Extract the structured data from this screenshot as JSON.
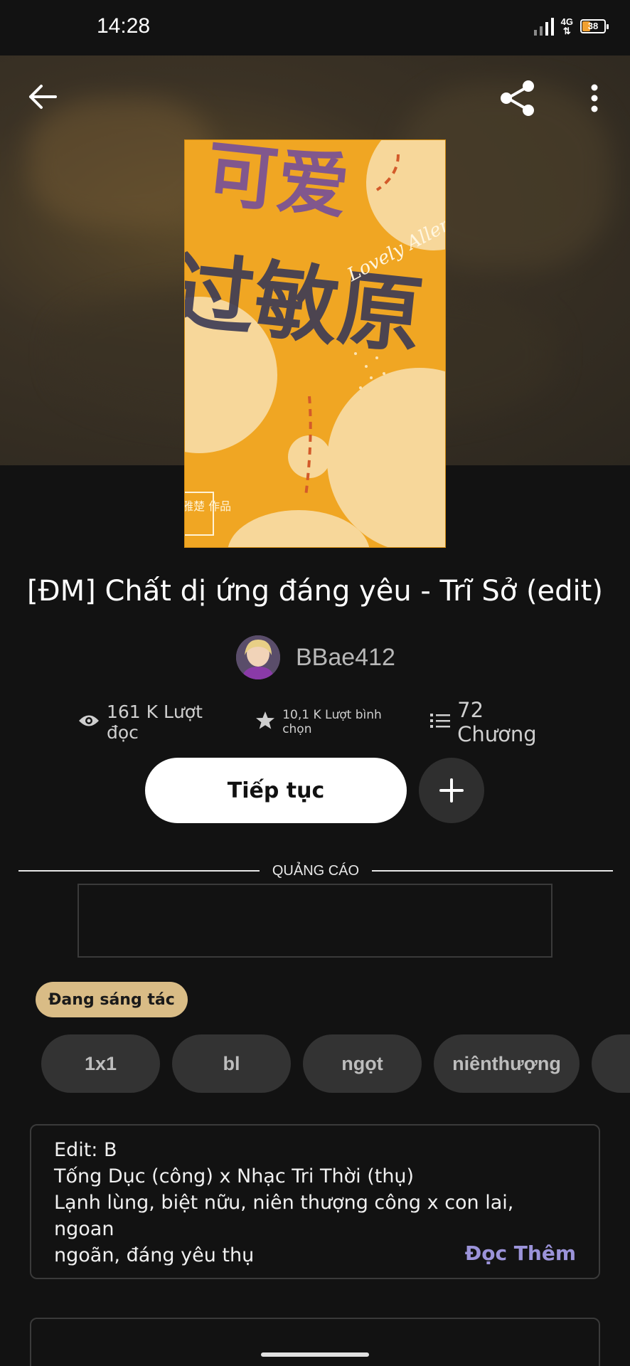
{
  "status_bar": {
    "time": "14:28",
    "network": "4G",
    "battery": "38"
  },
  "header": {
    "icons": [
      "back-arrow-icon",
      "share-icon",
      "more-vertical-icon"
    ]
  },
  "book": {
    "title": "[ĐM] Chất dị ứng đáng yêu - Trĩ Sở (edit)",
    "author": "BBae412",
    "cover_text": {
      "line1": "可爱",
      "line2": "过敏原",
      "script": "Lovely Allergen",
      "seal": "雅楚 作品"
    }
  },
  "stats": {
    "reads": "161 K Lượt đọc",
    "votes": "10,1 K Lượt bình chọn",
    "chapters": "72 Chương"
  },
  "actions": {
    "continue_label": "Tiếp tục"
  },
  "ad": {
    "label": "QUẢNG CÁO"
  },
  "status_badge": "Đang sáng tác",
  "tags": [
    "1x1",
    "bl",
    "ngọt",
    "niênthượng"
  ],
  "description": {
    "lines": [
      "Edit: B",
      "Tống Dục (công) x Nhạc Tri Thời (thụ)",
      "Lạnh lùng, biệt nữu, niên thượng công x con lai, ngoan",
      "ngoãn, đáng yêu thụ"
    ],
    "read_more": "Đọc Thêm"
  },
  "colors": {
    "background": "#121212",
    "badge": "#d9bc86",
    "read_more": "#9b93d9",
    "cover": "#f0a623"
  }
}
